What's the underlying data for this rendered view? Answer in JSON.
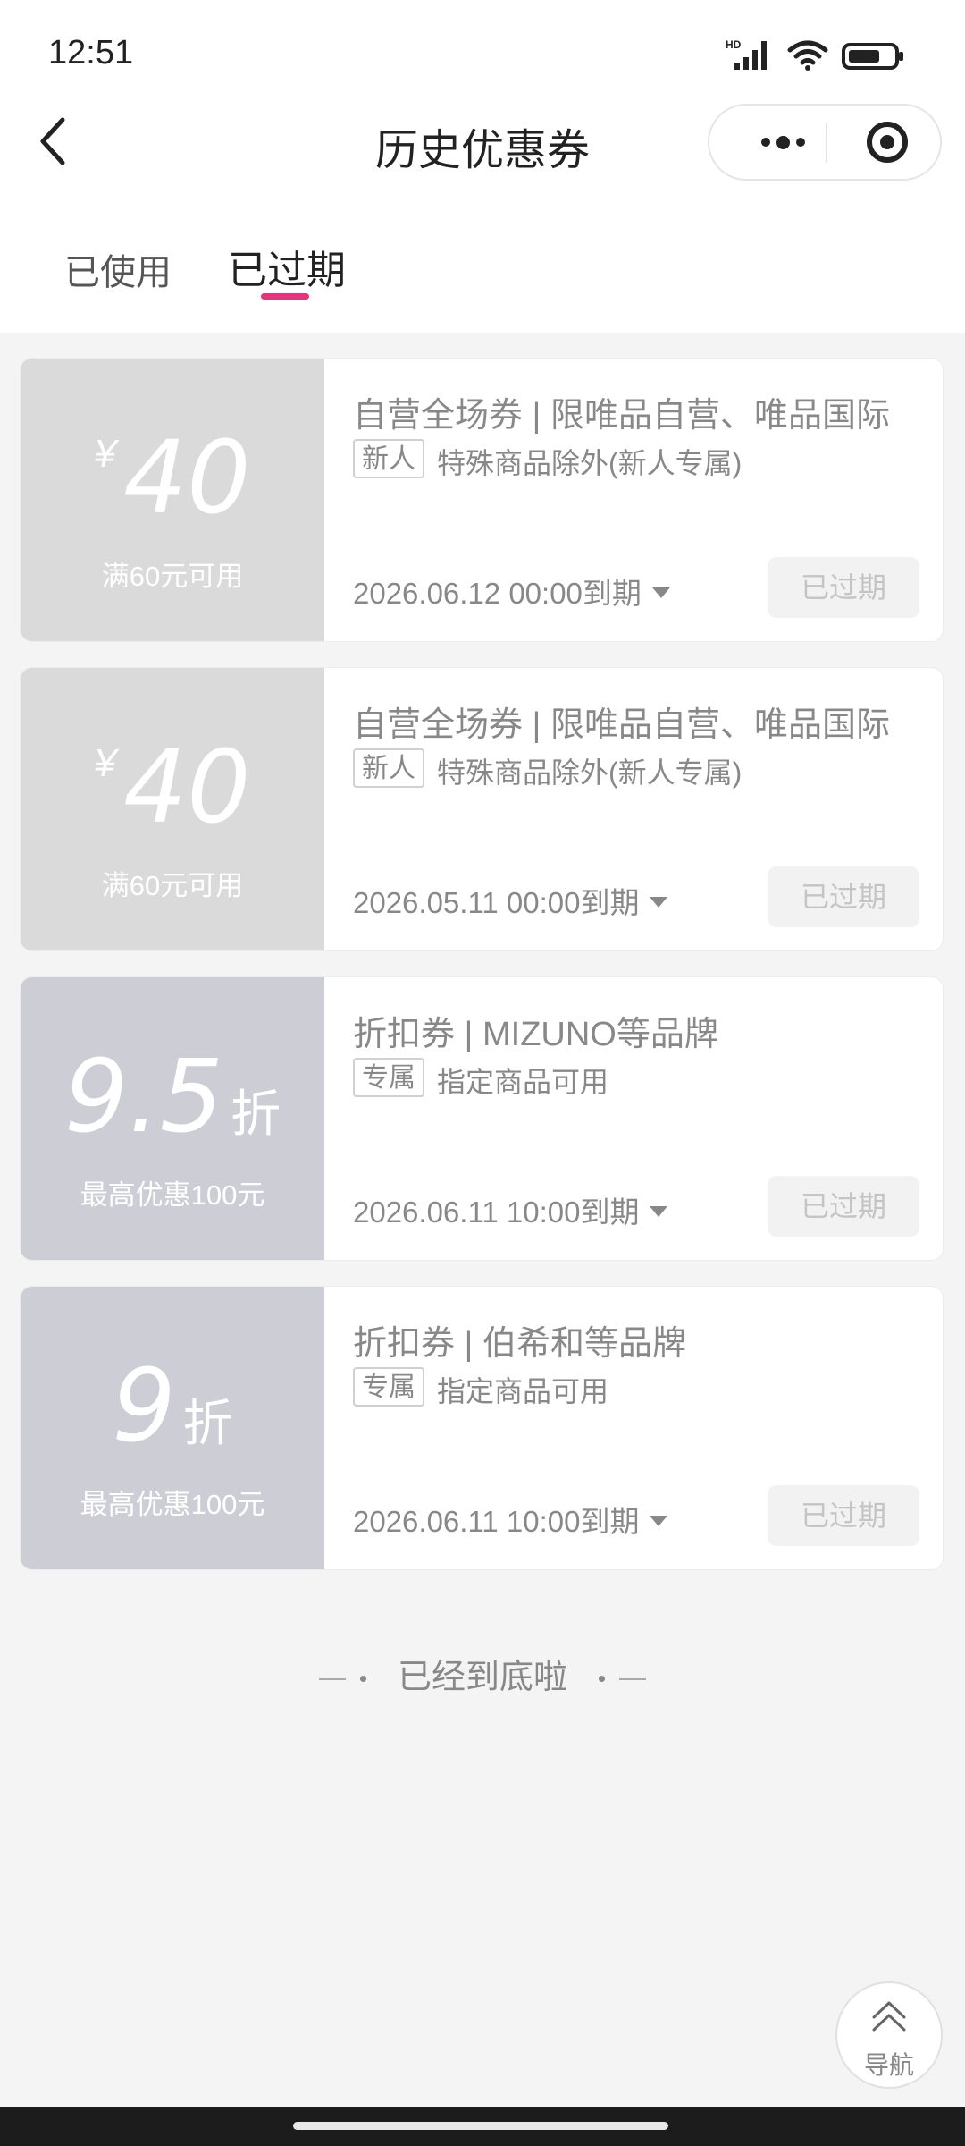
{
  "status_bar": {
    "time": "12:51",
    "network": "HD"
  },
  "header": {
    "title": "历史优惠券"
  },
  "tabs": [
    {
      "label": "已使用",
      "active": false
    },
    {
      "label": "已过期",
      "active": true
    }
  ],
  "coupons": [
    {
      "currency": "¥",
      "amount": "40",
      "unit": "",
      "condition": "满60元可用",
      "title": "自营全场券 | 限唯品自营、唯品国际",
      "tag": "新人",
      "desc": "特殊商品除外(新人专属)",
      "expiry": "2026.06.12 00:00到期",
      "status": "已过期"
    },
    {
      "currency": "¥",
      "amount": "40",
      "unit": "",
      "condition": "满60元可用",
      "title": "自营全场券 | 限唯品自营、唯品国际",
      "tag": "新人",
      "desc": "特殊商品除外(新人专属)",
      "expiry": "2026.05.11 00:00到期",
      "status": "已过期"
    },
    {
      "currency": "",
      "amount": "9.5",
      "unit": "折",
      "condition": "最高优惠100元",
      "title": "折扣券 | MIZUNO等品牌",
      "tag": "专属",
      "desc": "指定商品可用",
      "expiry": "2026.06.11 10:00到期",
      "status": "已过期"
    },
    {
      "currency": "",
      "amount": "9",
      "unit": "折",
      "condition": "最高优惠100元",
      "title": "折扣券 | 伯希和等品牌",
      "tag": "专属",
      "desc": "指定商品可用",
      "expiry": "2026.06.11 10:00到期",
      "status": "已过期"
    }
  ],
  "end_text": "已经到底啦",
  "nav_button": {
    "label": "导航"
  },
  "colors": {
    "accent": "#e8327a",
    "coupon_gray": "#dadada",
    "coupon_blue_gray": "#cdcdd6",
    "background": "#f4f4f4"
  }
}
